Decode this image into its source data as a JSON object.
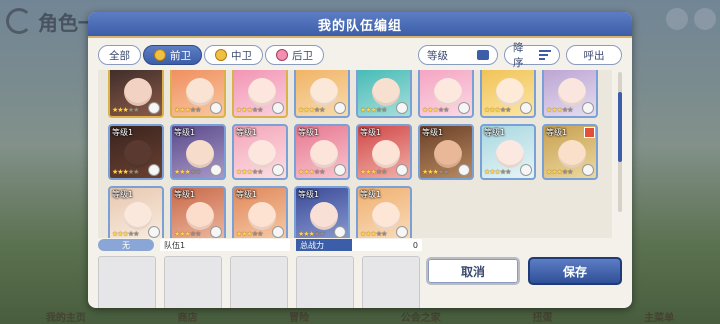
{
  "background": {
    "title": "角色一览",
    "bottom_menu": [
      "我的主页",
      "商店",
      "冒险",
      "公会之家",
      "扭蛋",
      "主菜单"
    ]
  },
  "dialog": {
    "title": "我的队伍编组",
    "tabs": [
      {
        "label": "全部",
        "active": false,
        "icon": ""
      },
      {
        "label": "前卫",
        "active": true,
        "icon": "front-icon"
      },
      {
        "label": "中卫",
        "active": false,
        "icon": "middle-icon"
      },
      {
        "label": "后卫",
        "active": false,
        "icon": "back-icon"
      }
    ],
    "sort_level": "等级",
    "sort_order": "降序",
    "call_out": "呼出",
    "characters": [
      {
        "level": "",
        "stars": 3,
        "max_stars": 5,
        "frame": "gold",
        "c1": "#3a2a28",
        "c2": "#8a5a48",
        "face": "#f2d2c2"
      },
      {
        "level": "",
        "stars": 3,
        "max_stars": 5,
        "frame": "gold",
        "c1": "#f08a5a",
        "c2": "#f7c8a0",
        "face": "#fbe3d3"
      },
      {
        "level": "",
        "stars": 3,
        "max_stars": 5,
        "frame": "gold",
        "c1": "#f28fb0",
        "c2": "#f9d1de",
        "face": "#fde6dd"
      },
      {
        "level": "",
        "stars": 3,
        "max_stars": 5,
        "frame": "blue",
        "c1": "#f0b060",
        "c2": "#f7dcae",
        "face": "#fce8d8"
      },
      {
        "level": "",
        "stars": 3,
        "max_stars": 5,
        "frame": "blue",
        "c1": "#3fb8b4",
        "c2": "#a7dfd9",
        "face": "#f8e0d0"
      },
      {
        "level": "",
        "stars": 3,
        "max_stars": 5,
        "frame": "blue",
        "c1": "#f4a0c0",
        "c2": "#fbd8e4",
        "face": "#fde8e0"
      },
      {
        "level": "",
        "stars": 3,
        "max_stars": 5,
        "frame": "blue",
        "c1": "#f0c050",
        "c2": "#fbe6a6",
        "face": "#fdebd8"
      },
      {
        "level": "",
        "stars": 3,
        "max_stars": 5,
        "frame": "blue",
        "c1": "#b8a0d0",
        "c2": "#e6dcf0",
        "face": "#fae6de"
      },
      {
        "level": "等级1",
        "stars": 3,
        "max_stars": 5,
        "frame": "blue",
        "c1": "#3a2420",
        "c2": "#6a4030",
        "face": "#5a3a30"
      },
      {
        "level": "等级1",
        "stars": 3,
        "max_stars": 5,
        "frame": "blue",
        "c1": "#5a4a8a",
        "c2": "#a898c8",
        "face": "#f6dccb"
      },
      {
        "level": "等级1",
        "stars": 3,
        "max_stars": 5,
        "frame": "blue",
        "c1": "#f4a6b8",
        "c2": "#fbdde4",
        "face": "#fde6de"
      },
      {
        "level": "等级1",
        "stars": 3,
        "max_stars": 5,
        "frame": "blue",
        "c1": "#e87890",
        "c2": "#f7c6d0",
        "face": "#fce4da"
      },
      {
        "level": "等级1",
        "stars": 3,
        "max_stars": 5,
        "frame": "blue",
        "c1": "#d04848",
        "c2": "#f2b0a8",
        "face": "#fde2d6"
      },
      {
        "level": "等级1",
        "stars": 3,
        "max_stars": 5,
        "frame": "blue",
        "c1": "#6a4028",
        "c2": "#b88a60",
        "face": "#e8b898"
      },
      {
        "level": "等级1",
        "stars": 3,
        "max_stars": 5,
        "frame": "blue",
        "c1": "#a8d8e0",
        "c2": "#e6f4f6",
        "face": "#fbe8e0"
      },
      {
        "level": "等级1",
        "stars": 3,
        "max_stars": 5,
        "frame": "blue",
        "c1": "#c8a050",
        "c2": "#ecd8a0",
        "face": "#fae0c8",
        "badge": true
      },
      {
        "level": "等级1",
        "stars": 3,
        "max_stars": 5,
        "frame": "blue",
        "c1": "#e8c8b0",
        "c2": "#f8ece0",
        "face": "#fbe8dc"
      },
      {
        "level": "等级1",
        "stars": 3,
        "max_stars": 5,
        "frame": "blue",
        "c1": "#c86848",
        "c2": "#eeb8a0",
        "face": "#fcdcca"
      },
      {
        "level": "等级1",
        "stars": 3,
        "max_stars": 5,
        "frame": "blue",
        "c1": "#e0885a",
        "c2": "#f6caa8",
        "face": "#fde2d2"
      },
      {
        "level": "等级1",
        "stars": 3,
        "max_stars": 5,
        "frame": "blue",
        "c1": "#3a4a98",
        "c2": "#8a9ad0",
        "face": "#f8e0d6"
      },
      {
        "level": "等级1",
        "stars": 3,
        "max_stars": 5,
        "frame": "blue",
        "c1": "#f0b070",
        "c2": "#f8dcbc",
        "face": "#fde6d6"
      }
    ],
    "team": {
      "chip": "无",
      "name": "队伍1",
      "power_label": "总战力",
      "power_value": "0"
    },
    "cancel_label": "取消",
    "save_label": "保存"
  }
}
